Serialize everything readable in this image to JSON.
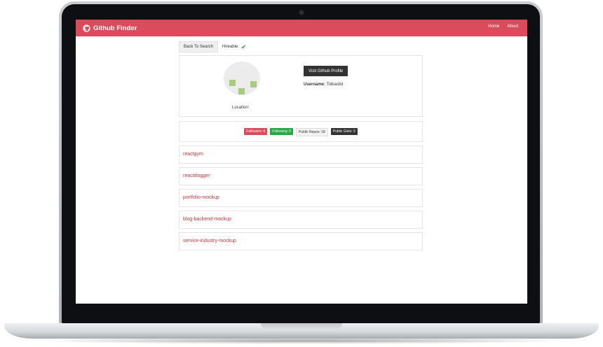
{
  "app": {
    "brand": "Github Finder",
    "nav": [
      {
        "label": "Home"
      },
      {
        "label": "About"
      }
    ]
  },
  "toolbar": {
    "back_label": "Back To Search",
    "hireable_label": "Hireable:",
    "hireable_icon": "check-icon"
  },
  "profile": {
    "location_label": "Location:",
    "visit_label": "Visit Github Profile",
    "username_label": "Username:",
    "username_value": "Tobiasltd"
  },
  "stats": [
    {
      "label": "Followers: 6",
      "variant": "red"
    },
    {
      "label": "Following: 0",
      "variant": "green"
    },
    {
      "label": "Public Repos: 18",
      "variant": "light"
    },
    {
      "label": "Public Gists: 0",
      "variant": "dark"
    }
  ],
  "repos": [
    {
      "name": "reactgym"
    },
    {
      "name": "reactitlogger"
    },
    {
      "name": "portfolio-mockup"
    },
    {
      "name": "blog-backend-mockup"
    },
    {
      "name": "service-industry-mockup"
    }
  ],
  "colors": {
    "navbar": "#dc4b5b",
    "link": "#c0323f",
    "success": "#28a745",
    "dark": "#333333"
  }
}
